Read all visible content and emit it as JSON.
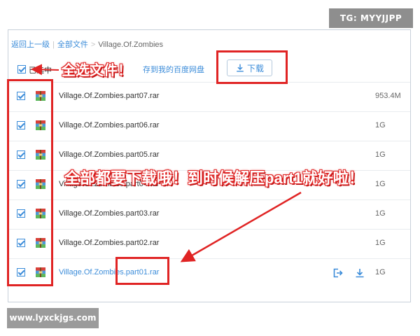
{
  "watermarks": {
    "top_right": "TG: MYYJJPP",
    "bottom_left": "www.lyxckjgs.com"
  },
  "breadcrumb": {
    "back": "返回上一级",
    "all_files": "全部文件",
    "current": "Village.Of.Zombies"
  },
  "toolbar": {
    "selected_label": "已选中",
    "save_to_cloud": "存到我的百度网盘",
    "download_label": "下载"
  },
  "files": [
    {
      "name": "Village.Of.Zombies.part07.rar",
      "size": "953.4M",
      "checked": true
    },
    {
      "name": "Village.Of.Zombies.part06.rar",
      "size": "1G",
      "checked": true
    },
    {
      "name": "Village.Of.Zombies.part05.rar",
      "size": "1G",
      "checked": true
    },
    {
      "name": "Village.Of.Zombies.part04.rar",
      "size": "1G",
      "checked": true
    },
    {
      "name": "Village.Of.Zombies.part03.rar",
      "size": "1G",
      "checked": true
    },
    {
      "name": "Village.Of.Zombies.part02.rar",
      "size": "1G",
      "checked": true
    },
    {
      "name": "Village.Of.Zombies.part01.rar",
      "size": "1G",
      "checked": true
    }
  ],
  "annotations": {
    "select_all": "全选文件！",
    "download_all": "全部都要下载哦！到时候解压part1就好啦！"
  },
  "colors": {
    "accent_blue": "#3b8cd9",
    "annotation_red": "#e02424"
  },
  "icons": {
    "download": "download-icon",
    "share": "share-icon",
    "file": "rar-archive-icon"
  }
}
